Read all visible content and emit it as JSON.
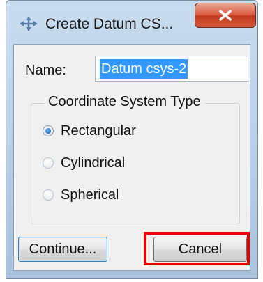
{
  "window": {
    "title": "Create Datum CS...",
    "title_icon": "datum-csys-icon",
    "close_icon": "close-icon"
  },
  "form": {
    "name_label": "Name:",
    "name_value": "Datum csys-2",
    "group_title": "Coordinate System Type",
    "options": [
      {
        "label": "Rectangular",
        "checked": true
      },
      {
        "label": "Cylindrical",
        "checked": false
      },
      {
        "label": "Spherical",
        "checked": false
      }
    ]
  },
  "buttons": {
    "continue_label": "Continue...",
    "cancel_label": "Cancel"
  },
  "colors": {
    "selection": "#3399ff",
    "highlight": "#e60000",
    "close": "#c23a1f"
  }
}
